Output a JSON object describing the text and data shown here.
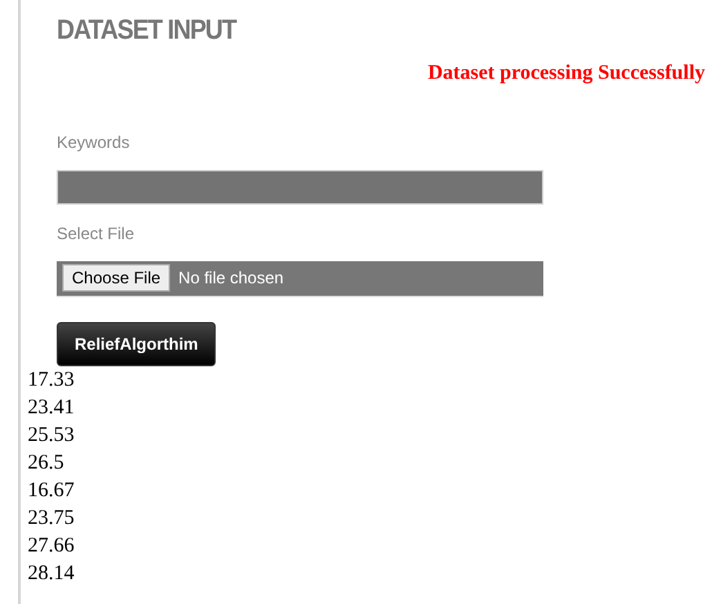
{
  "heading": "DATASET INPUT",
  "message": "Dataset processing Successfully",
  "keywords": {
    "label": "Keywords"
  },
  "file": {
    "label": "Select File",
    "button": "Choose File",
    "status": "No file chosen"
  },
  "submit": "ReliefAlgorthim",
  "results": [
    "17.33",
    "23.41",
    "25.53",
    "26.5",
    "16.67",
    "23.75",
    "27.66",
    "28.14"
  ]
}
